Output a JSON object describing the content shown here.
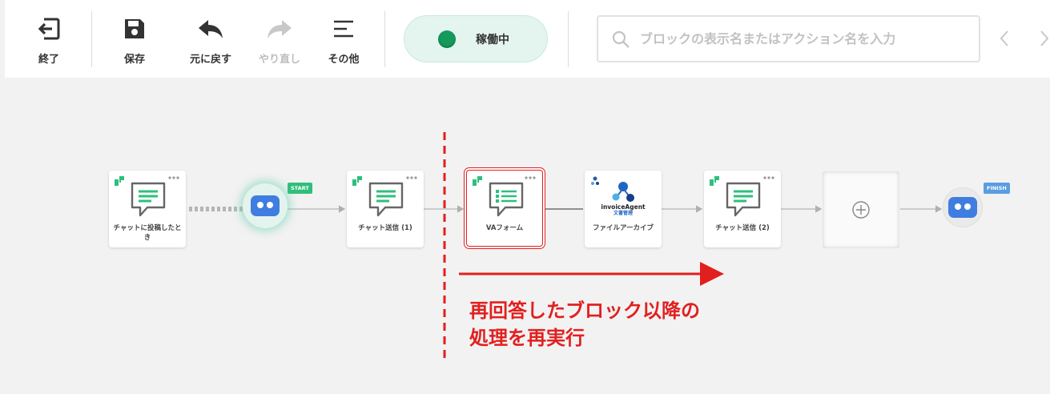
{
  "toolbar": {
    "exit_label": "終了",
    "save_label": "保存",
    "undo_label": "元に戻す",
    "redo_label": "やり直し",
    "more_label": "その他",
    "status_label": "稼働中",
    "search_placeholder": "ブロックの表示名またはアクション名を入力"
  },
  "flow": {
    "nodes": [
      {
        "label": "チャットに投稿したとき"
      },
      {
        "label": "チャット送信 (1)"
      },
      {
        "label": "VAフォーム"
      },
      {
        "label": "ファイルアーカイブ"
      },
      {
        "label": "チャット送信 (2)"
      }
    ],
    "start_tag": "START",
    "finish_tag": "FINISH",
    "invoice_logo_title": "invoiceAgent",
    "invoice_logo_sub": "文書管理"
  },
  "annotation": {
    "line1": "再回答したブロック以降の",
    "line2": "処理を再実行"
  },
  "colors": {
    "accent_green": "#159a5c",
    "node_icon_green": "#2fbf7b",
    "bot_blue": "#3f7de0",
    "annotation_red": "#e21f1f"
  }
}
